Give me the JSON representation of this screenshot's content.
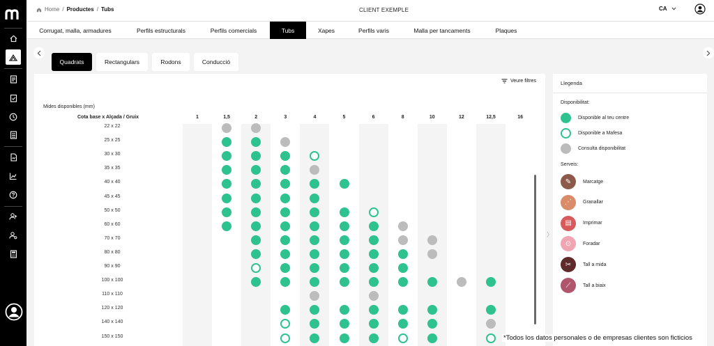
{
  "breadcrumb": {
    "home": "Home",
    "sep": "/",
    "section": "Productes",
    "current": "Tubs"
  },
  "header": {
    "client": "CLIENT EXEMPLE",
    "language": "CA"
  },
  "category_tabs": [
    "Corrugat, malla, armadures",
    "Perfils estructurals",
    "Perfils comercials",
    "Tubs",
    "Xapes",
    "Perfils varis",
    "Malla per tancaments",
    "Plaques"
  ],
  "active_category": "Tubs",
  "sub_tabs": [
    "Quadrats",
    "Rectangulars",
    "Rodons",
    "Conducció"
  ],
  "active_sub_tab": "Quadrats",
  "filters_label": "Veure filtres",
  "table": {
    "title": "Mides disponibles (mm)",
    "header_label": "Cota base x Alçada / Gruix",
    "columns": [
      "1",
      "1,5",
      "2",
      "3",
      "4",
      "5",
      "6",
      "8",
      "10",
      "12",
      "12,5",
      "16"
    ],
    "rows": [
      {
        "label": "22 x 22",
        "cells": [
          "",
          "c",
          "c",
          "",
          "",
          "",
          "",
          "",
          "",
          "",
          "",
          ""
        ]
      },
      {
        "label": "25 x 25",
        "cells": [
          "",
          "g",
          "g",
          "c",
          "",
          "",
          "",
          "",
          "",
          "",
          "",
          ""
        ]
      },
      {
        "label": "30 x 30",
        "cells": [
          "",
          "g",
          "g",
          "g",
          "o",
          "",
          "",
          "",
          "",
          "",
          "",
          ""
        ]
      },
      {
        "label": "35 x 35",
        "cells": [
          "",
          "g",
          "g",
          "g",
          "c",
          "",
          "",
          "",
          "",
          "",
          "",
          ""
        ]
      },
      {
        "label": "40 x 40",
        "cells": [
          "",
          "g",
          "g",
          "g",
          "g",
          "g",
          "",
          "",
          "",
          "",
          "",
          ""
        ]
      },
      {
        "label": "45 x 45",
        "cells": [
          "",
          "g",
          "g",
          "g",
          "g",
          "",
          "",
          "",
          "",
          "",
          "",
          ""
        ]
      },
      {
        "label": "50 x 50",
        "cells": [
          "",
          "g",
          "g",
          "g",
          "g",
          "g",
          "o",
          "",
          "",
          "",
          "",
          ""
        ]
      },
      {
        "label": "60 x 60",
        "cells": [
          "",
          "g",
          "g",
          "g",
          "g",
          "g",
          "g",
          "c",
          "",
          "",
          "",
          ""
        ]
      },
      {
        "label": "70 x 70",
        "cells": [
          "",
          "",
          "g",
          "g",
          "g",
          "g",
          "g",
          "c",
          "c",
          "",
          "",
          ""
        ]
      },
      {
        "label": "80 x 80",
        "cells": [
          "",
          "",
          "g",
          "g",
          "g",
          "g",
          "g",
          "g",
          "c",
          "",
          "",
          ""
        ]
      },
      {
        "label": "90 x 90",
        "cells": [
          "",
          "",
          "o",
          "g",
          "g",
          "g",
          "g",
          "g",
          "",
          "",
          "",
          ""
        ]
      },
      {
        "label": "100 x 100",
        "cells": [
          "",
          "",
          "g",
          "g",
          "g",
          "g",
          "g",
          "g",
          "g",
          "c",
          "g",
          ""
        ]
      },
      {
        "label": "110 x 110",
        "cells": [
          "",
          "",
          "",
          "",
          "c",
          "",
          "c",
          "",
          "",
          "",
          "",
          ""
        ]
      },
      {
        "label": "120 x 120",
        "cells": [
          "",
          "",
          "",
          "g",
          "g",
          "g",
          "g",
          "g",
          "g",
          "",
          "g",
          ""
        ]
      },
      {
        "label": "140 x 140",
        "cells": [
          "",
          "",
          "",
          "o",
          "g",
          "g",
          "g",
          "g",
          "g",
          "",
          "c",
          ""
        ]
      },
      {
        "label": "150 x 150",
        "cells": [
          "",
          "",
          "",
          "o",
          "g",
          "g",
          "g",
          "o",
          "g",
          "",
          "o",
          ""
        ]
      }
    ]
  },
  "legend": {
    "title": "Llegenda",
    "availability_title": "Disponibilitat:",
    "availability": [
      {
        "key": "g",
        "label": "Disponible al teu centre"
      },
      {
        "key": "o",
        "label": "Disponible a Mafesa"
      },
      {
        "key": "c",
        "label": "Consulta disponibilitat"
      }
    ],
    "services_title": "Serveis:",
    "services": [
      {
        "label": "Marcatge",
        "color": "#8b5a4a",
        "icon": "marking-icon"
      },
      {
        "label": "Granallar",
        "color": "#d98b6a",
        "icon": "blasting-icon"
      },
      {
        "label": "Imprimar",
        "color": "#d95a5a",
        "icon": "priming-icon"
      },
      {
        "label": "Foradar",
        "color": "#f0a5b2",
        "icon": "drilling-icon"
      },
      {
        "label": "Tall a mida",
        "color": "#5e2a2a",
        "icon": "cut-to-size-icon"
      },
      {
        "label": "Tall a biaix",
        "color": "#b0566c",
        "icon": "bevel-cut-icon"
      }
    ]
  },
  "colors": {
    "available_local": "#2ec28f",
    "consult": "#bcbcbc",
    "sidebar": "#000000"
  },
  "disclaimer": "*Todos los datos personales o de empresas clientes son ficticios"
}
